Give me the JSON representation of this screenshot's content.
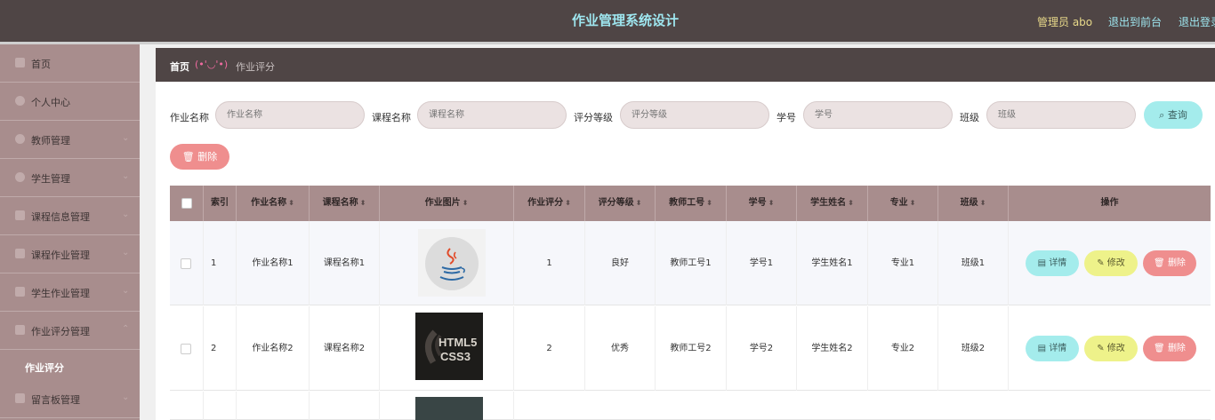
{
  "header": {
    "title": "作业管理系统设计",
    "admin": "管理员 abo",
    "to_front": "退出到前台",
    "logout": "退出登录"
  },
  "sidebar": {
    "items": [
      {
        "label": "首页",
        "icon": "home-icon"
      },
      {
        "label": "个人中心",
        "icon": "user-icon"
      },
      {
        "label": "教师管理",
        "icon": "teacher-icon"
      },
      {
        "label": "学生管理",
        "icon": "student-icon"
      },
      {
        "label": "课程信息管理",
        "icon": "course-icon"
      },
      {
        "label": "课程作业管理",
        "icon": "homework-icon"
      },
      {
        "label": "学生作业管理",
        "icon": "student-homework-icon"
      },
      {
        "label": "作业评分管理",
        "icon": "score-icon"
      },
      {
        "label": "留言板管理",
        "icon": "message-icon"
      }
    ],
    "active_sub": "作业评分"
  },
  "breadcrumb": {
    "home": "首页",
    "face": "(•'◡'•)",
    "current": "作业评分"
  },
  "filters": [
    {
      "label": "作业名称",
      "placeholder": "作业名称"
    },
    {
      "label": "课程名称",
      "placeholder": "课程名称"
    },
    {
      "label": "评分等级",
      "placeholder": "评分等级"
    },
    {
      "label": "学号",
      "placeholder": "学号"
    },
    {
      "label": "班级",
      "placeholder": "班级"
    }
  ],
  "actions": {
    "query": "查询",
    "delete": "删除"
  },
  "table": {
    "columns": [
      "索引",
      "作业名称",
      "课程名称",
      "作业图片",
      "作业评分",
      "评分等级",
      "教师工号",
      "学号",
      "学生姓名",
      "专业",
      "班级",
      "操作"
    ],
    "rows": [
      {
        "index": "1",
        "homework": "作业名称1",
        "course": "课程名称1",
        "image": "java-logo",
        "score": "1",
        "grade": "良好",
        "teacher_id": "教师工号1",
        "student_id": "学号1",
        "student_name": "学生姓名1",
        "major": "专业1",
        "class": "班级1"
      },
      {
        "index": "2",
        "homework": "作业名称2",
        "course": "课程名称2",
        "image": "html5-css3-cover",
        "score": "2",
        "grade": "优秀",
        "teacher_id": "教师工号2",
        "student_id": "学号2",
        "student_name": "学生姓名2",
        "major": "专业2",
        "class": "班级2"
      }
    ],
    "row_actions": {
      "detail": "详情",
      "edit": "修改",
      "delete": "删除"
    }
  },
  "colors": {
    "header_bg": "#4f4545",
    "sidebar_bg": "#a88d8d",
    "title_color": "#9ee6ef",
    "detail_btn": "#a4ecec",
    "edit_btn": "#eef28a",
    "delete_btn": "#ef8e8e"
  }
}
